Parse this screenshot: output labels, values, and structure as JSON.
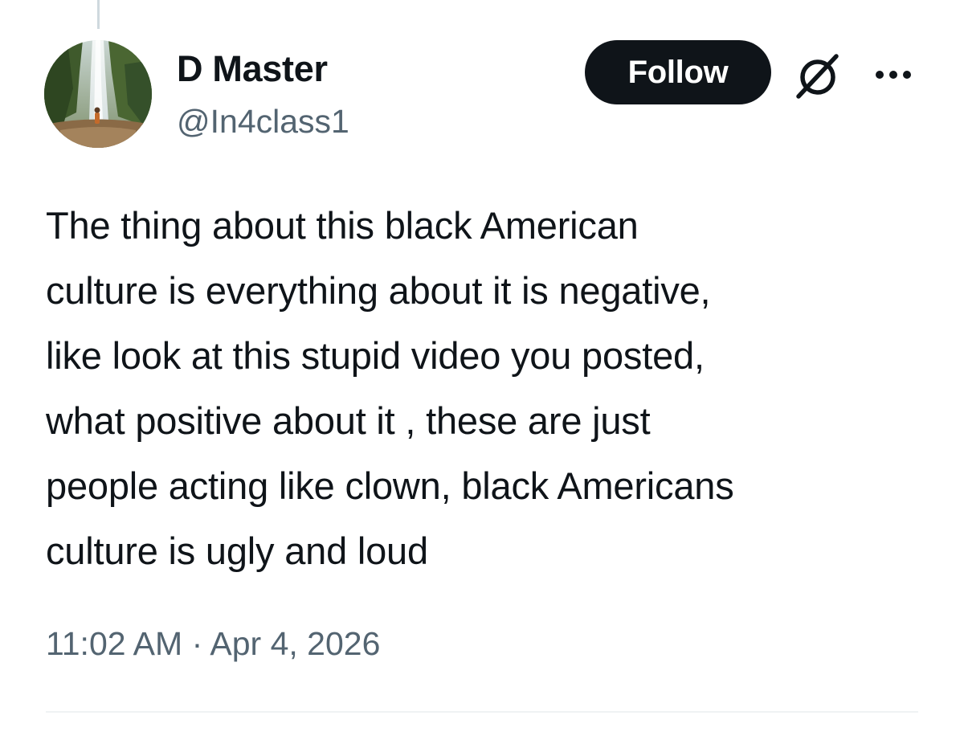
{
  "author": {
    "display_name": "D Master",
    "handle": "@In4class1",
    "avatar": "waterfall-photo"
  },
  "actions": {
    "follow_label": "Follow",
    "grok_icon": "grok-slash-icon",
    "more_icon": "more-horizontal-icon"
  },
  "tweet": {
    "text": "The thing about this black American\nculture is everything about it is negative,\nlike look at this stupid video you posted,\nwhat positive about it , these are just\npeople acting like clown, black Americans\nculture is ugly and loud",
    "time": "11:02 AM",
    "separator": "·",
    "date": "Apr 4, 2026"
  },
  "colors": {
    "text_primary": "#0f1419",
    "text_secondary": "#536471",
    "button_bg": "#0f1419",
    "button_text": "#ffffff",
    "divider": "#eff3f4"
  }
}
